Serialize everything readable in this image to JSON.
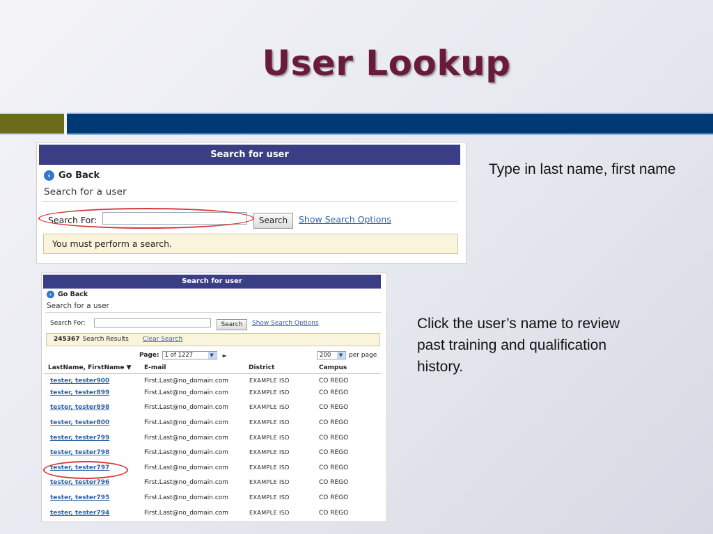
{
  "slide": {
    "title": "User Lookup",
    "caption_1": "Type in last name, first name",
    "caption_2": "Click the user’s name to review past training and qualification history.",
    "colors": {
      "title": "#6a1a3a",
      "band_olive": "#6b6b1b",
      "band_navy": "#003a75",
      "highlight_ring": "#d83a3a"
    }
  },
  "screen_1": {
    "header": "Search for user",
    "go_back": "Go Back",
    "go_back_icon": "arrow-left-circle-icon",
    "subtitle": "Search for a user",
    "search_label": "Search For:",
    "search_value": "",
    "search_button": "Search",
    "options_link": "Show Search Options",
    "notice": "You must perform a search."
  },
  "screen_2": {
    "header": "Search for user",
    "go_back": "Go Back",
    "subtitle": "Search for a user",
    "search_label": "Search For:",
    "search_value": "",
    "search_button": "Search",
    "options_link": "Show Search Options",
    "result_count": "245367",
    "result_text": "Search Results",
    "clear_link": "Clear Search",
    "page_label": "Page:",
    "page_select": "1 of 1227",
    "per_page_select": "200",
    "per_page_label": "per page",
    "columns": [
      "LastName, FirstName ▼",
      "E-mail",
      "District",
      "Campus"
    ],
    "rows": [
      {
        "name": "tester, tester900",
        "email": "First.Last@no_domain.com",
        "district": "EXAMPLE ISD",
        "campus": "CO REGO"
      },
      {
        "name": "tester, tester899",
        "email": "First.Last@no_domain.com",
        "district": "EXAMPLE ISD",
        "campus": "CO REGO"
      },
      {
        "name": "tester, tester898",
        "email": "First.Last@no_domain.com",
        "district": "EXAMPLE ISD",
        "campus": "CO REGO"
      },
      {
        "name": "tester, tester800",
        "email": "First.Last@no_domain.com",
        "district": "EXAMPLE ISD",
        "campus": "CO REGO"
      },
      {
        "name": "tester, tester799",
        "email": "First.Last@no_domain.com",
        "district": "EXAMPLE ISD",
        "campus": "CO REGO"
      },
      {
        "name": "tester, tester798",
        "email": "First.Last@no_domain.com",
        "district": "EXAMPLE ISD",
        "campus": "CO REGO"
      },
      {
        "name": "tester, tester797",
        "email": "First.Last@no_domain.com",
        "district": "EXAMPLE ISD",
        "campus": "CO REGO"
      },
      {
        "name": "tester, tester796",
        "email": "First.Last@no_domain.com",
        "district": "EXAMPLE ISD",
        "campus": "CO REGO"
      },
      {
        "name": "tester, tester795",
        "email": "First.Last@no_domain.com",
        "district": "EXAMPLE ISD",
        "campus": "CO REGO"
      },
      {
        "name": "tester, tester794",
        "email": "First.Last@no_domain.com",
        "district": "EXAMPLE ISD",
        "campus": "CO REGO"
      }
    ]
  }
}
